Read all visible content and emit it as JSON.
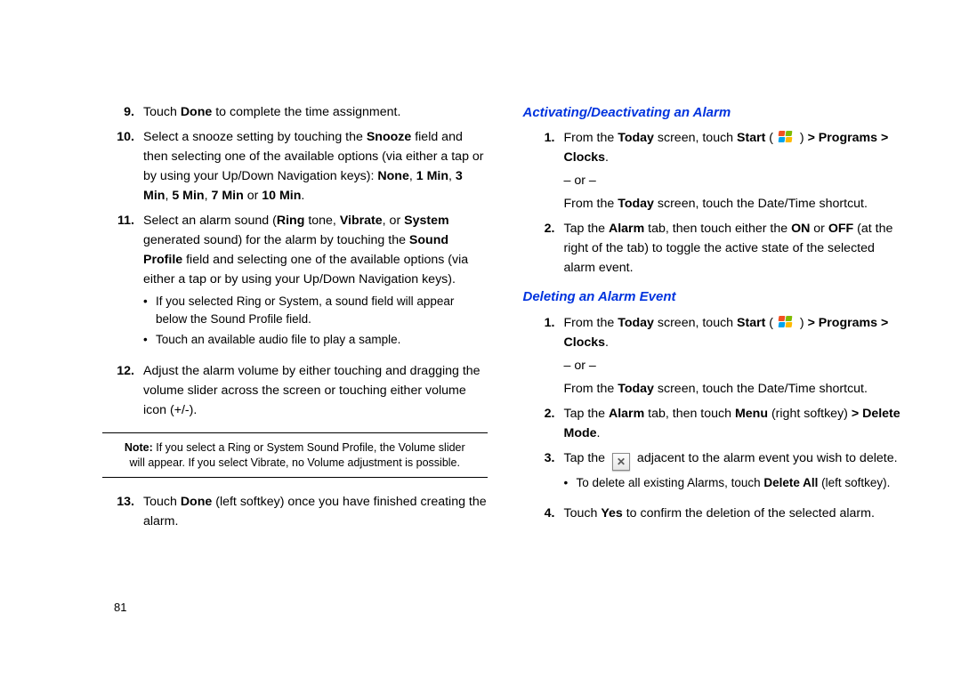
{
  "page_number": "81",
  "left": {
    "items": [
      {
        "n": "9.",
        "html": "Touch <b>Done</b> to complete the time assignment."
      },
      {
        "n": "10.",
        "html": "Select a snooze setting by touching the <b>Snooze</b> field and then selecting one of the available options (via either a tap or by using your Up/Down Navigation keys): <b>None</b>, <b>1 Min</b>, <b>3 Min</b>, <b>5 Min</b>, <b>7 Min</b> or <b>10 Min</b>."
      },
      {
        "n": "11.",
        "html": "Select an alarm sound (<b>Ring</b> tone, <b>Vibrate</b>, or <b>System</b> generated sound) for the alarm by touching the <b>Sound Profile</b> field and selecting one of the available options (via either a tap or by using your Up/Down Navigation keys).",
        "bullets": [
          "If you selected Ring or System, a sound field will appear below the Sound Profile field.",
          "Touch an available audio file to play a sample."
        ]
      },
      {
        "n": "12.",
        "html": "Adjust the alarm volume by either touching and dragging the volume slider across the screen or touching either volume icon (+/-)."
      }
    ],
    "note_label": "Note:",
    "note_text": "If you select a Ring or System Sound Profile, the Volume slider will appear. If you select Vibrate, no Volume adjustment is possible.",
    "after_note": [
      {
        "n": "13.",
        "html": "Touch <b>Done</b> (left softkey) once you have finished creating the alarm."
      }
    ]
  },
  "right": {
    "h1": "Activating/Deactivating an Alarm",
    "s1": [
      {
        "n": "1.",
        "html": "From the <b>Today</b> screen, touch <b>Start</b> ( <span class='winflag'><span class='wf1'></span><span class='wf2'></span><span class='wf3'></span><span class='wf4'></span></span> ) <b>> Programs > Clocks</b>.",
        "or": "– or –",
        "after": "From the <b>Today</b> screen, touch the Date/Time shortcut."
      },
      {
        "n": "2.",
        "html": "Tap the <b>Alarm</b> tab, then touch either the <b>ON</b> or <b>OFF</b> (at the right of the tab) to toggle the active state of the selected alarm event."
      }
    ],
    "h2": "Deleting an Alarm Event",
    "s2": [
      {
        "n": "1.",
        "html": "From the <b>Today</b> screen, touch <b>Start</b> ( <span class='winflag'><span class='wf1'></span><span class='wf2'></span><span class='wf3'></span><span class='wf4'></span></span> ) <b>> Programs > Clocks</b>.",
        "or": "– or –",
        "after": "From the <b>Today</b> screen, touch the Date/Time shortcut."
      },
      {
        "n": "2.",
        "html": "Tap the <b>Alarm</b> tab, then touch <b>Menu</b> (right softkey) <b>> Delete Mode</b>."
      },
      {
        "n": "3.",
        "html": "Tap the <span class='xbtn'>✕</span> adjacent to the alarm event you wish to delete.",
        "bullets": [
          "To delete all existing Alarms, touch <b>Delete All</b> (left softkey)."
        ]
      },
      {
        "n": "4.",
        "html": "Touch <b>Yes</b> to confirm the deletion of the selected alarm."
      }
    ]
  }
}
